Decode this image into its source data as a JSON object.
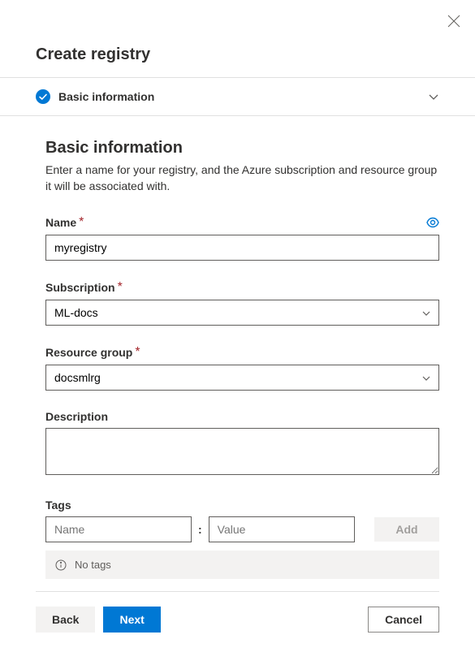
{
  "close_label": "Close",
  "title": "Create registry",
  "step": {
    "label": "Basic information"
  },
  "section": {
    "heading": "Basic information",
    "description": "Enter a name for your registry, and the Azure subscription and resource group it will be associated with."
  },
  "fields": {
    "name": {
      "label": "Name",
      "value": "myregistry",
      "required": "*"
    },
    "subscription": {
      "label": "Subscription",
      "value": "ML-docs",
      "required": "*"
    },
    "resource_group": {
      "label": "Resource group",
      "value": "docsmlrg",
      "required": "*"
    },
    "description": {
      "label": "Description",
      "value": ""
    }
  },
  "tags": {
    "label": "Tags",
    "name_placeholder": "Name",
    "value_placeholder": "Value",
    "add_label": "Add",
    "no_tags": "No tags"
  },
  "footer": {
    "back": "Back",
    "next": "Next",
    "cancel": "Cancel"
  }
}
